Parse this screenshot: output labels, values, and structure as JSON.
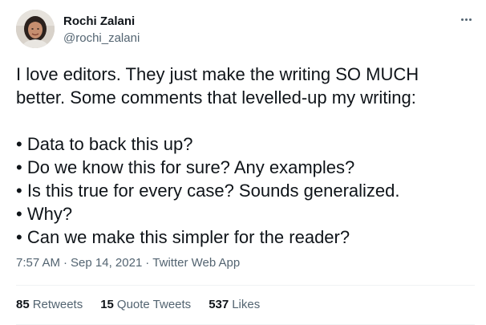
{
  "author": {
    "display_name": "Rochi Zalani",
    "handle": "@rochi_zalani",
    "avatar_icon": "profile-photo"
  },
  "more_icon": "ellipsis-icon",
  "tweet": {
    "intro_line1": "I love editors. They just make the writing SO MUCH",
    "intro_line2": "better. Some comments that levelled-up my writing:",
    "bullets": [
      "• Data to back this up?",
      "• Do we know this for sure? Any examples?",
      "• Is this true for every case? Sounds generalized.",
      "• Why?",
      "• Can we make this simpler for the reader?"
    ]
  },
  "meta": {
    "time": "7:57 AM",
    "separator": "·",
    "date": "Sep 14, 2021",
    "source": "Twitter Web App"
  },
  "stats": {
    "retweets_count": "85",
    "retweets_label": "Retweets",
    "quote_count": "15",
    "quote_label": "Quote Tweets",
    "likes_count": "537",
    "likes_label": "Likes"
  },
  "colors": {
    "text": "#0f1419",
    "secondary": "#536471",
    "divider": "#eff3f4"
  }
}
